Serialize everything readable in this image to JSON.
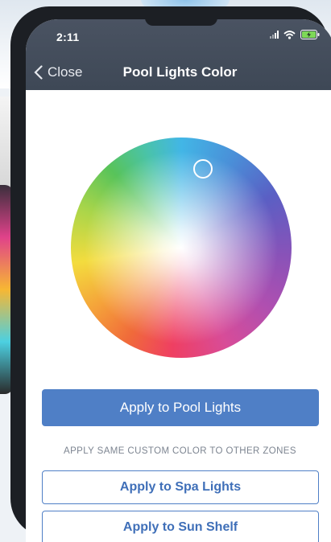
{
  "status_bar": {
    "time": "2:11"
  },
  "nav": {
    "back_label": "Close",
    "title": "Pool Lights Color"
  },
  "color_picker": {
    "icon": "color-wheel"
  },
  "actions": {
    "primary_label": "Apply to Pool Lights",
    "zones_caption": "APPLY SAME CUSTOM COLOR TO OTHER ZONES",
    "spa_label": "Apply to Spa Lights",
    "sun_shelf_label": "Apply to Sun Shelf"
  },
  "colors": {
    "accent": "#4f7fc6",
    "navbar": "#434c5a"
  }
}
